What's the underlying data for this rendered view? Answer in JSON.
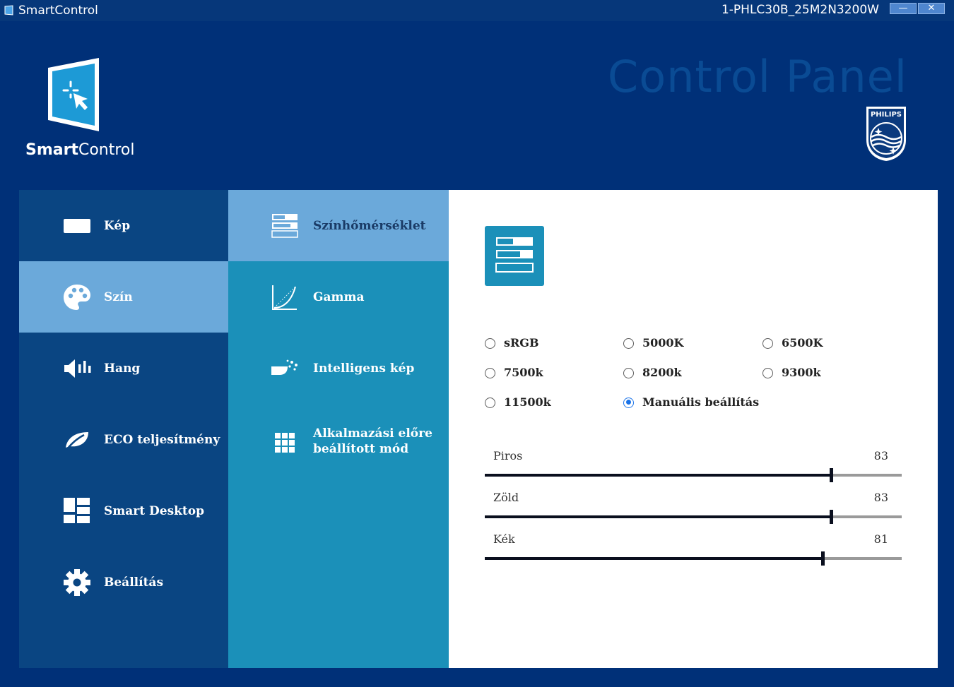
{
  "window": {
    "app_title": "SmartControl",
    "model": "1-PHLC30B_25M2N3200W",
    "minimize_label": "—",
    "close_label": "✕"
  },
  "header": {
    "logo_bold": "Smart",
    "logo_rest": "Control",
    "title": "Control Panel",
    "brand": "PHILIPS"
  },
  "nav": {
    "items": [
      {
        "label": "Kép",
        "icon": "monitor-icon"
      },
      {
        "label": "Szín",
        "icon": "palette-icon",
        "active": true
      },
      {
        "label": "Hang",
        "icon": "speaker-icon"
      },
      {
        "label": "ECO teljesítmény",
        "icon": "leaf-icon"
      },
      {
        "label": "Smart Desktop",
        "icon": "window-tiles-icon"
      },
      {
        "label": "Beállítás",
        "icon": "gear-icon"
      }
    ]
  },
  "subnav": {
    "items": [
      {
        "label": "Színhőmérséklet",
        "icon": "color-temperature-icon",
        "active": true
      },
      {
        "label": "Gamma",
        "icon": "gamma-curve-icon"
      },
      {
        "label": "Intelligens kép",
        "icon": "smart-image-icon"
      },
      {
        "label": "Alkalmazási előre beállított mód",
        "line1": "Alkalmazási előre",
        "line2": "beállított mód",
        "icon": "grid-icon"
      }
    ]
  },
  "content": {
    "options": [
      {
        "label": "sRGB",
        "checked": false
      },
      {
        "label": "5000K",
        "checked": false
      },
      {
        "label": "6500K",
        "checked": false
      },
      {
        "label": "7500k",
        "checked": false
      },
      {
        "label": "8200k",
        "checked": false
      },
      {
        "label": "9300k",
        "checked": false
      },
      {
        "label": "11500k",
        "checked": false
      },
      {
        "label": "Manuális beállítás",
        "checked": true
      }
    ],
    "sliders": [
      {
        "label": "Piros",
        "value": "83",
        "level": 83
      },
      {
        "label": "Zöld",
        "value": "83",
        "level": 83
      },
      {
        "label": "Kék",
        "value": "81",
        "level": 81
      }
    ]
  },
  "colors": {
    "background": "#003078",
    "nav_bg": "#0a4582",
    "subnav_bg": "#1b90b9",
    "active_bg": "#6ba9da",
    "accent_radio": "#1a73e8"
  }
}
